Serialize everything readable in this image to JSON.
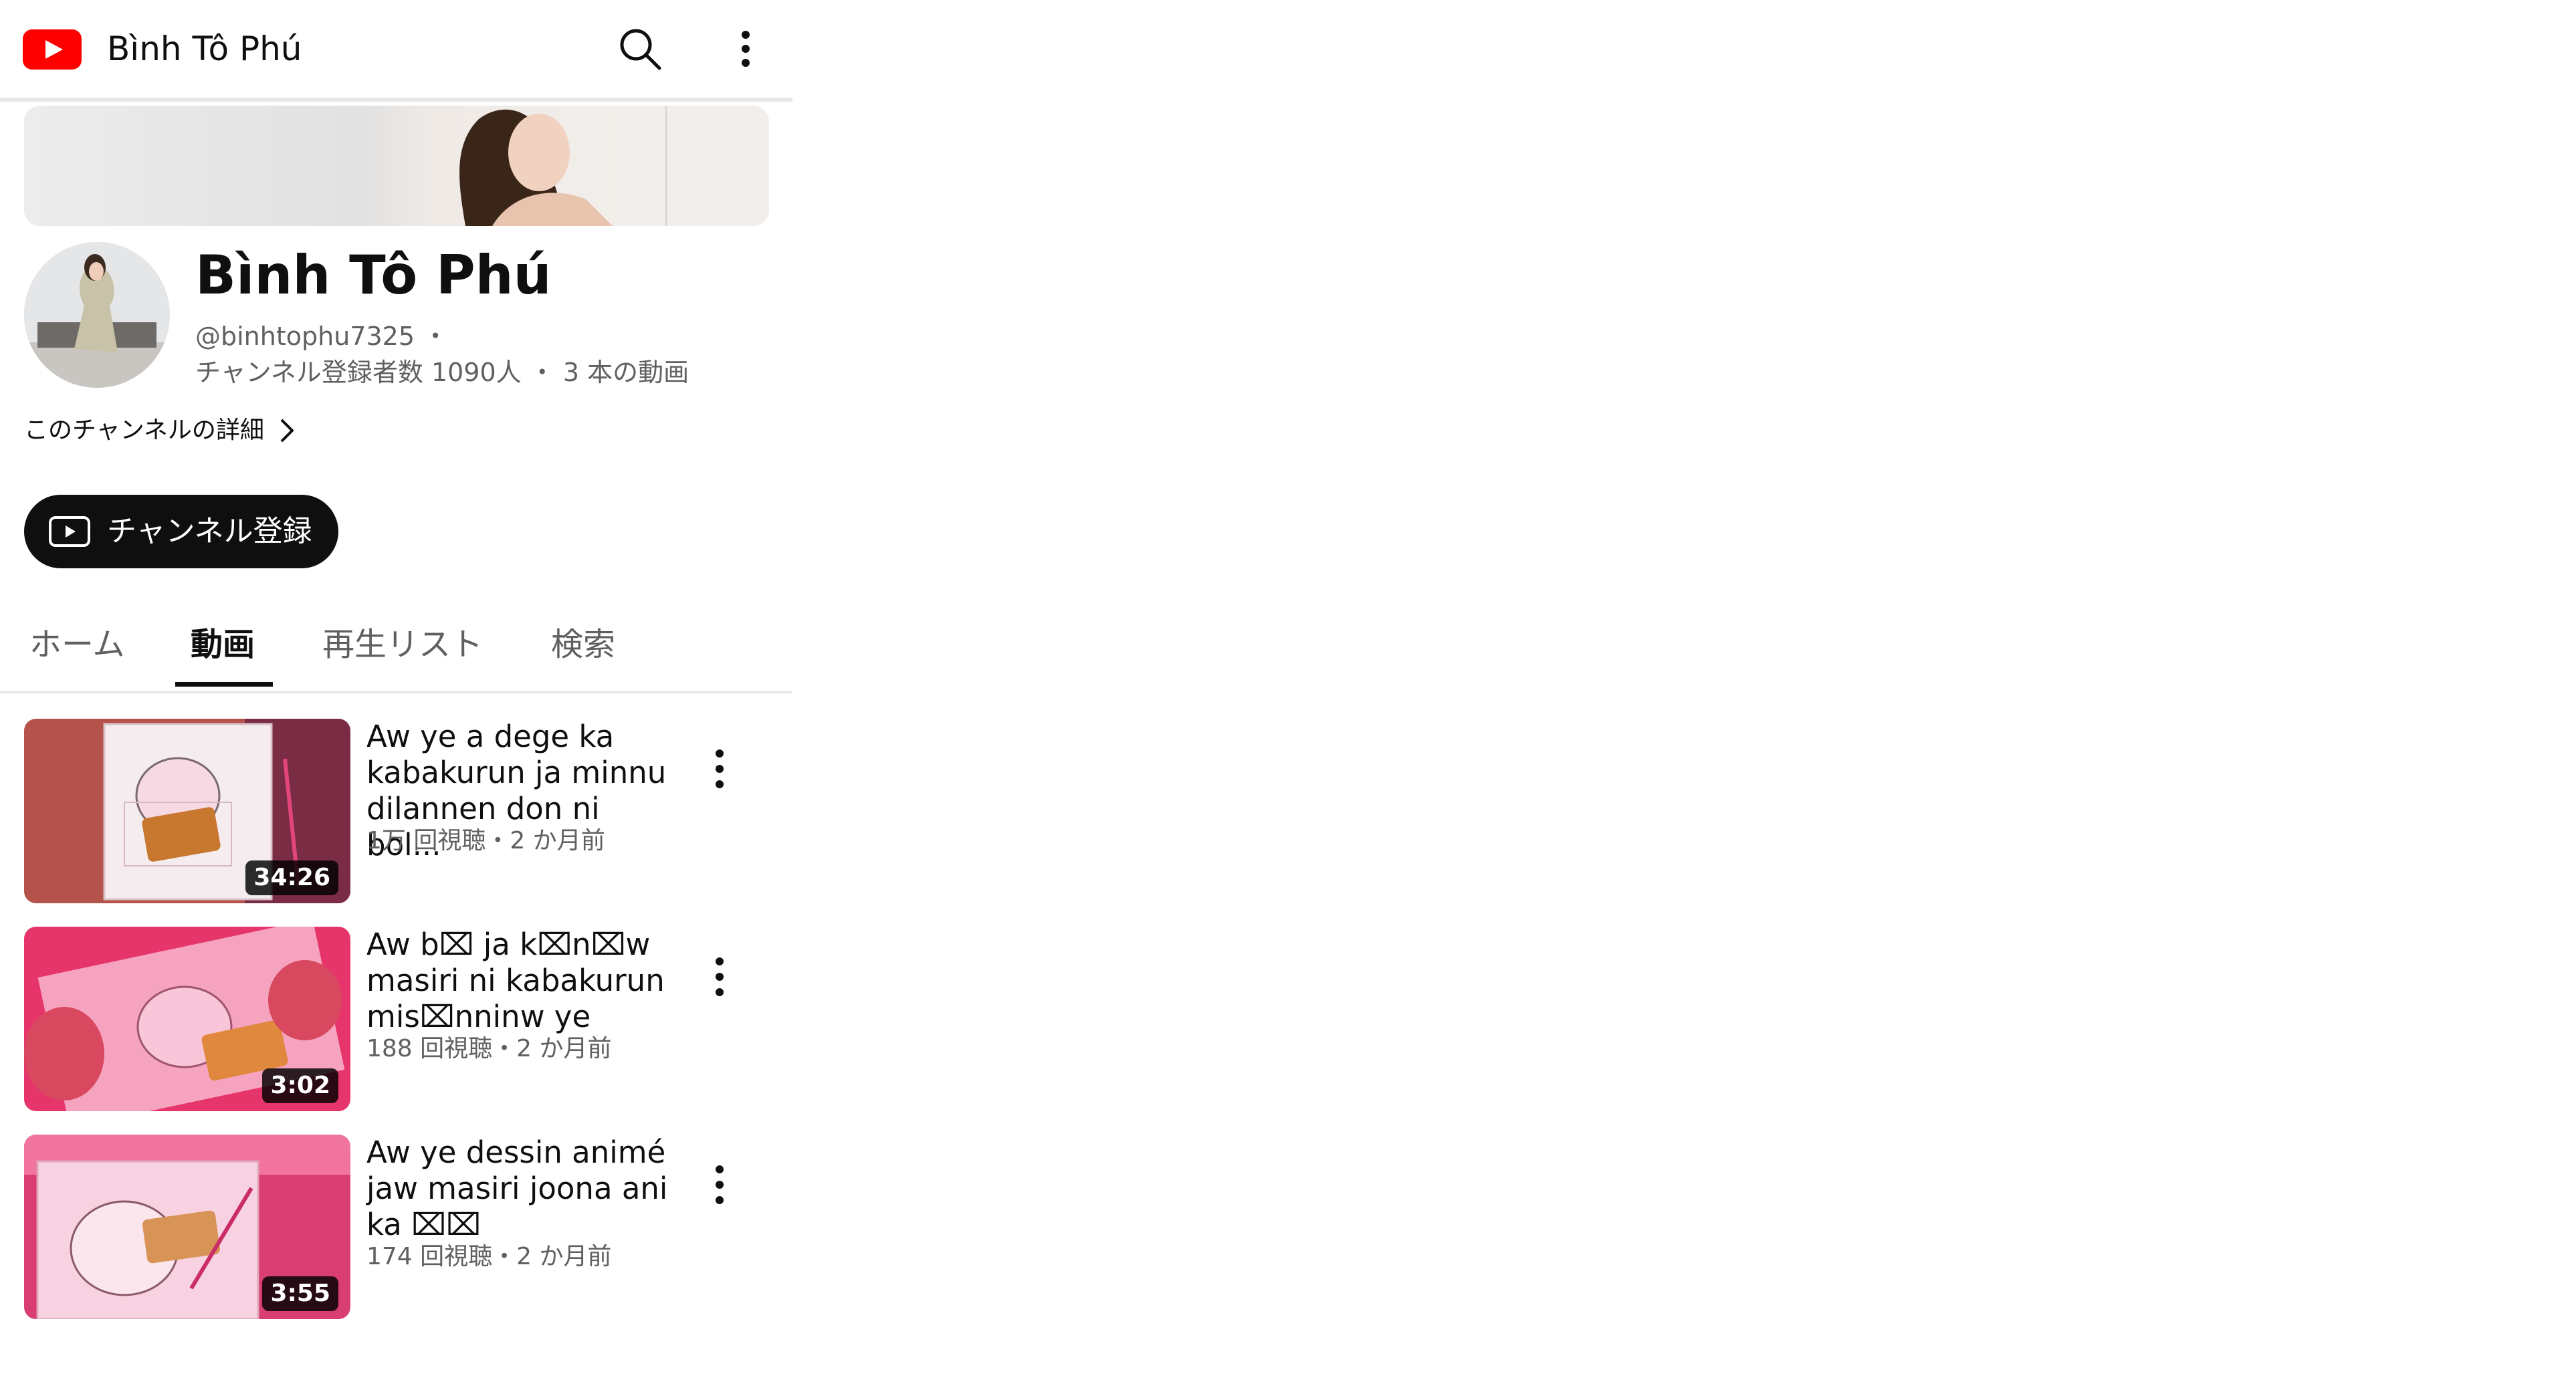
{
  "header": {
    "title": "Bình Tô Phú"
  },
  "channel": {
    "name": "Bình Tô Phú",
    "handle": "@binhtophu7325",
    "handle_separator": "・",
    "subscribers": "チャンネル登録者数 1090人",
    "stats_separator": "・",
    "video_count": "3 本の動画",
    "details_link": "このチャンネルの詳細",
    "subscribe_label": "チャンネル登録"
  },
  "tabs": [
    {
      "label": "ホーム"
    },
    {
      "label": "動画"
    },
    {
      "label": "再生リスト"
    },
    {
      "label": "検索"
    }
  ],
  "active_tab": "動画",
  "videos": [
    {
      "title": "Aw ye a dege ka kabakurun ja minnu dilannen don ni bol...",
      "meta": "1万 回視聴・2 か月前",
      "duration": "34:26"
    },
    {
      "title": "Aw b⌧ ja k⌧n⌧w masiri ni kabakurun mis⌧nninw ye",
      "meta": "188 回視聴・2 か月前",
      "duration": "3:02"
    },
    {
      "title": "Aw ye dessin animé jaw masiri joona ani ka ⌧⌧",
      "meta": "174 回視聴・2 か月前",
      "duration": "3:55"
    }
  ],
  "colors": {
    "brand_red": "#ff0000",
    "text_primary": "#0f0f0f",
    "text_secondary": "#606060"
  }
}
